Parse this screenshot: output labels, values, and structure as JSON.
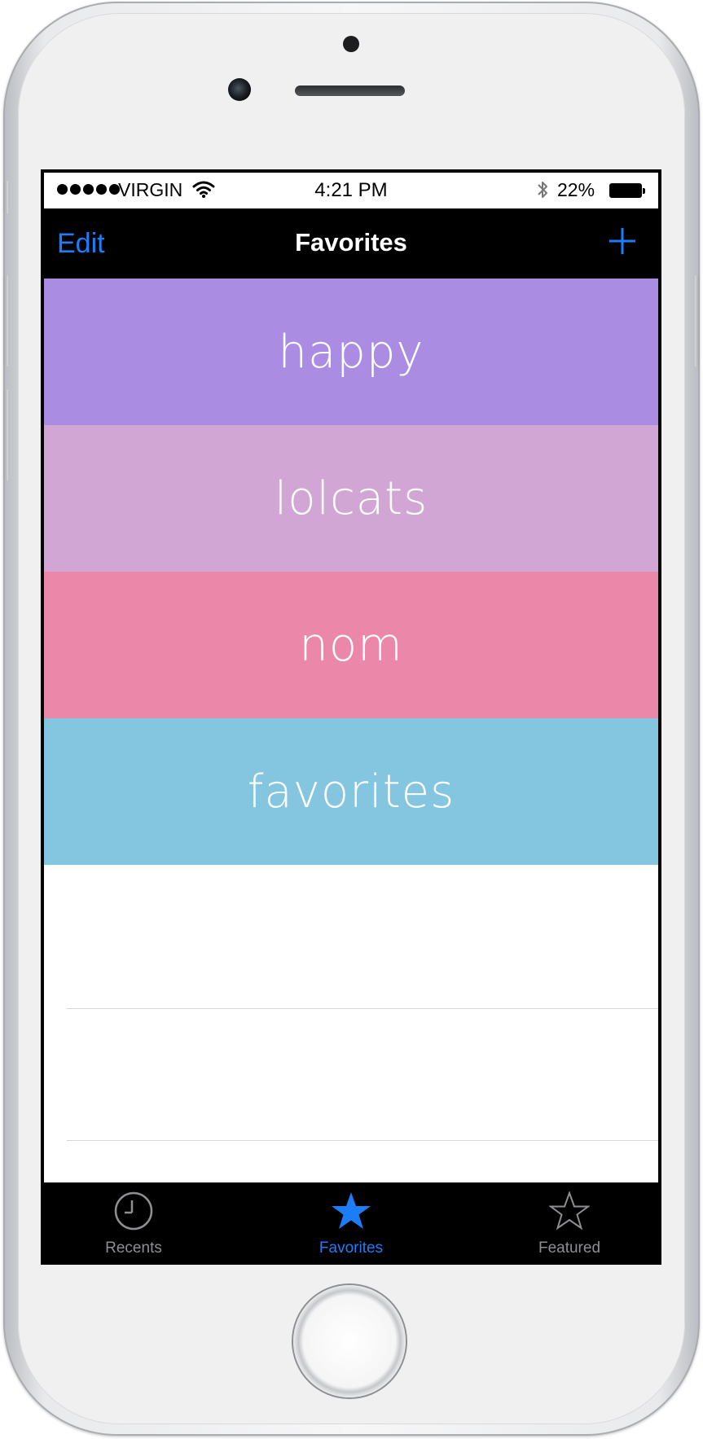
{
  "status_bar": {
    "carrier": "VIRGIN",
    "time": "4:21 PM",
    "battery": "22%",
    "icons": [
      "signal-dots",
      "wifi-icon",
      "bluetooth-icon",
      "battery-icon"
    ]
  },
  "nav": {
    "edit_label": "Edit",
    "title": "Favorites",
    "add_icon": "plus-icon"
  },
  "favorites": [
    {
      "label": "happy",
      "color": "#aa8ce3"
    },
    {
      "label": "lolcats",
      "color": "#d1a6d4"
    },
    {
      "label": "nom",
      "color": "#eb87a9"
    },
    {
      "label": "favorites",
      "color": "#84c5e0"
    }
  ],
  "tabs": [
    {
      "label": "Recents",
      "icon": "clock-icon",
      "active": false
    },
    {
      "label": "Favorites",
      "icon": "star-filled-icon",
      "active": true
    },
    {
      "label": "Featured",
      "icon": "star-outline-icon",
      "active": false
    }
  ],
  "colors": {
    "accent": "#1b7ef8",
    "bar_background": "#000000",
    "inactive_tab": "#8e8e93"
  }
}
